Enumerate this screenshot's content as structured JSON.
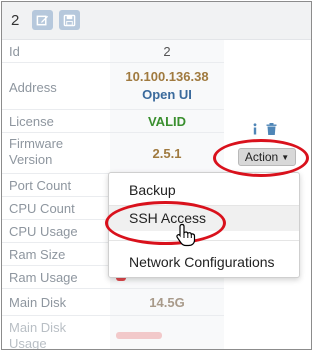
{
  "toolbar": {
    "count": "2",
    "icons": [
      "edit-icon",
      "save-icon"
    ]
  },
  "details": {
    "rows": [
      {
        "label": "Id",
        "value": "2"
      },
      {
        "label": "Address",
        "value": "10.100.136.38",
        "link": "Open UI"
      },
      {
        "label": "License",
        "value": "VALID"
      },
      {
        "label": "Firmware Version",
        "value": "2.5.1"
      },
      {
        "label": "Port Count",
        "value": ""
      },
      {
        "label": "CPU Count",
        "value": ""
      },
      {
        "label": "CPU Usage",
        "value": ""
      },
      {
        "label": "Ram Size",
        "value": ""
      },
      {
        "label": "Ram Usage",
        "value": ""
      },
      {
        "label": "Main Disk",
        "value": "14.5G"
      },
      {
        "label": "Main Disk Usage",
        "value": ""
      }
    ]
  },
  "actions": {
    "button_label": "Action",
    "menu": [
      "Backup",
      "SSH Access",
      "Network Configurations"
    ]
  },
  "colors": {
    "accent_red": "#d9111c",
    "value_brown": "#a07a3f",
    "link_blue": "#3a6a9c",
    "valid_green": "#3a8f2f"
  }
}
